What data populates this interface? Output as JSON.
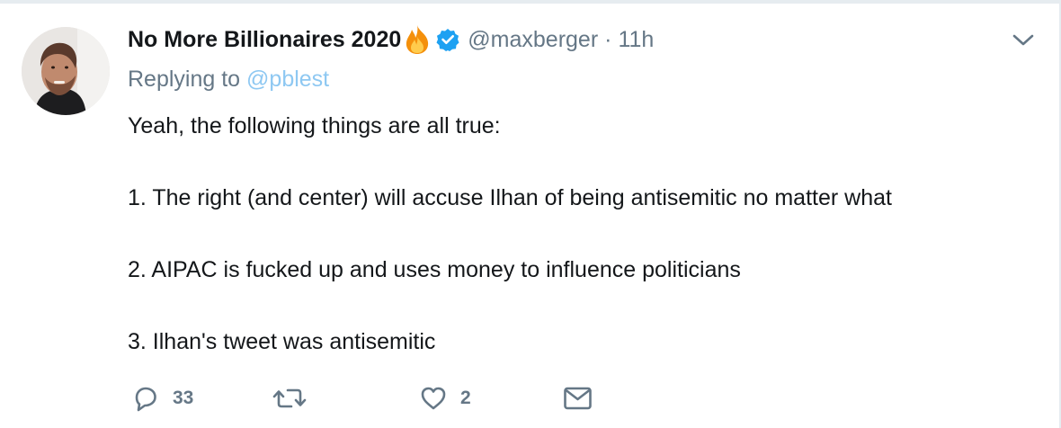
{
  "tweet": {
    "author_name": "No More Billionaires 2020",
    "name_emoji": "flame-icon",
    "verified": true,
    "handle": "@maxberger",
    "separator": "·",
    "time": "11h",
    "replying_prefix": "Replying to",
    "replying_to": "@pblest",
    "text_lines": [
      "Yeah, the following things are all true:",
      "",
      "1. The right (and center) will accuse Ilhan of being antisemitic no matter what",
      "",
      "2. AIPAC is fucked up and uses money to influence politicians",
      "",
      "3. Ilhan's tweet was antisemitic"
    ]
  },
  "actions": {
    "reply_count": "33",
    "retweet_count": "",
    "like_count": "2"
  },
  "icons": [
    "avatar",
    "flame-icon",
    "verified-icon",
    "chevron-down-icon",
    "reply-icon",
    "retweet-icon",
    "heart-icon",
    "mail-icon"
  ],
  "colors": {
    "text": "#14171a",
    "secondary": "#657786",
    "mention": "#8ec8f2",
    "verified": "#1da1f2",
    "divider": "#e6ecf0"
  }
}
